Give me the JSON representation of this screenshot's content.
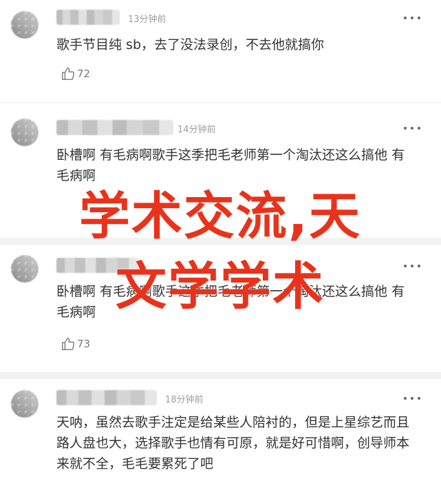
{
  "comments": [
    {
      "time": "13分钟前",
      "text": "歌手节目纯 sb，去了没法录创，不去他就搞你",
      "likes": "72"
    },
    {
      "time": "14分钟前",
      "text": "卧槽啊 有毛病啊歌手这季把毛老师第一个淘汰还这么搞他 有毛病啊",
      "likes": ""
    },
    {
      "time": "",
      "text": "卧槽啊 有毛病啊歌手这季把毛老师第一个淘汰还这么搞他 有毛病啊",
      "likes": "73"
    },
    {
      "time": "18分钟前",
      "text": "天呐，虽然去歌手注定是给某些人陪衬的，但是上星综艺而且路人盘也大，选择歌手也情有可原，就是好可惜啊，创导师本来就不全，毛毛要累死了吧",
      "likes": ""
    }
  ],
  "overlay": {
    "line1": "学术交流,天",
    "line2": "文学学术"
  },
  "icons": {
    "more": "more-dots-icon",
    "like": "thumbs-up-icon"
  },
  "colors": {
    "overlay_red": "#e8331c",
    "text": "#333333",
    "meta": "#9e9e9e"
  }
}
